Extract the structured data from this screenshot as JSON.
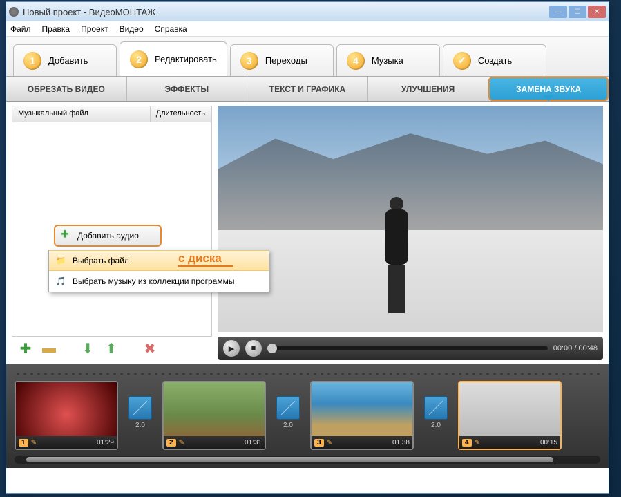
{
  "window_title": "Новый проект - ВидеоМОНТАЖ",
  "menu": {
    "file": "Файл",
    "edit": "Правка",
    "project": "Проект",
    "video": "Видео",
    "help": "Справка"
  },
  "steps": {
    "s1": "Добавить",
    "s2": "Редактировать",
    "s3": "Переходы",
    "s4": "Музыка",
    "s5": "Создать"
  },
  "subtabs": {
    "crop": "ОБРЕЗАТЬ ВИДЕО",
    "effects": "ЭФФЕКТЫ",
    "text": "ТЕКСТ И ГРАФИКА",
    "enhance": "УЛУЧШЕНИЯ",
    "audio": "ЗАМЕНА ЗВУКА"
  },
  "list_headers": {
    "file": "Музыкальный файл",
    "duration": "Длительность"
  },
  "add_audio_btn": "Добавить аудио",
  "annotation": "с диска",
  "popup": {
    "choose_file": "Выбрать файл",
    "choose_collection": "Выбрать музыку из коллекции программы"
  },
  "player": {
    "time": "00:00 / 00:48"
  },
  "transitions_duration": "2.0",
  "clips": [
    {
      "idx": "1",
      "dur": "01:29"
    },
    {
      "idx": "2",
      "dur": "01:31"
    },
    {
      "idx": "3",
      "dur": "01:38"
    },
    {
      "idx": "4",
      "dur": "00:15"
    }
  ]
}
